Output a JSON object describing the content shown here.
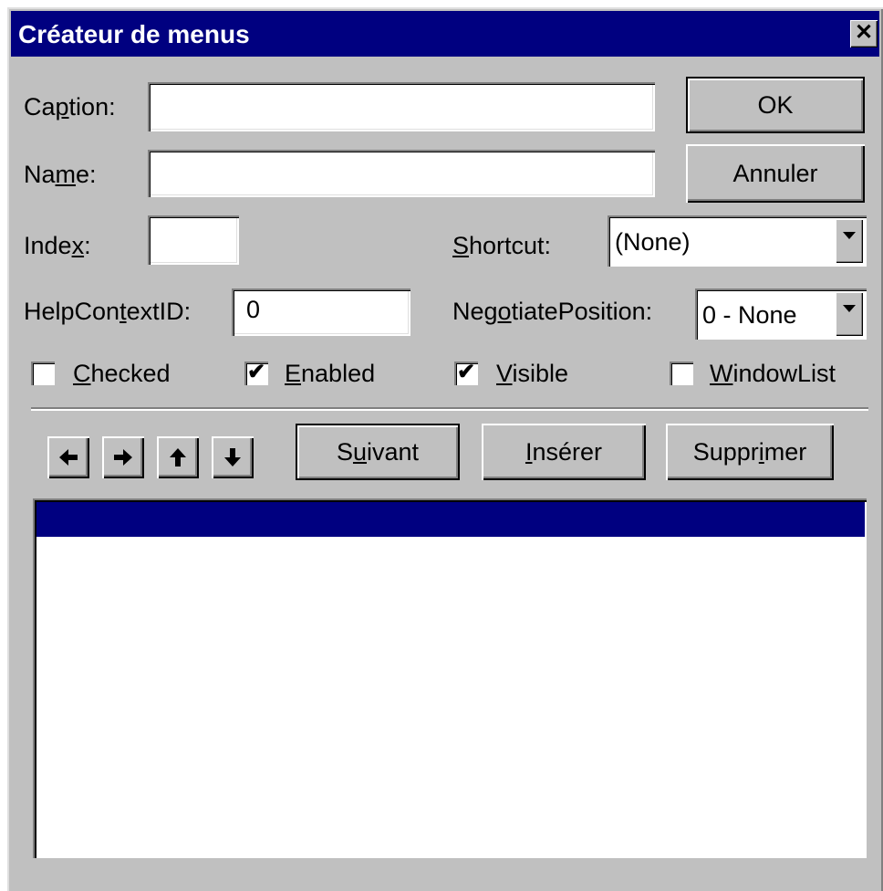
{
  "window": {
    "title": "Créateur de menus",
    "close_label": "✕"
  },
  "form": {
    "caption": {
      "label_pre": "Ca",
      "label_key": "p",
      "label_post": "tion:",
      "value": ""
    },
    "name": {
      "label_pre": "Na",
      "label_key": "m",
      "label_post": "e:",
      "value": ""
    },
    "index": {
      "label_pre": "Inde",
      "label_key": "x",
      "label_post": ":",
      "value": ""
    },
    "shortcut": {
      "label_key": "S",
      "label_post": "hortcut:",
      "value": "(None)"
    },
    "helpcontext": {
      "label_pre": "HelpCon",
      "label_key": "t",
      "label_post": "extID:",
      "value": "0"
    },
    "negotiate": {
      "label_pre": "Neg",
      "label_key": "o",
      "label_post": "tiatePosition:",
      "value": "0 - None"
    },
    "checkboxes": [
      {
        "label_key": "C",
        "label_post": "hecked",
        "checked": false
      },
      {
        "label_key": "E",
        "label_post": "nabled",
        "checked": true
      },
      {
        "label_key": "V",
        "label_post": "isible",
        "checked": true
      },
      {
        "label_key": "W",
        "label_post": "indowList",
        "checked": false
      }
    ]
  },
  "buttons": {
    "ok": "OK",
    "cancel": "Annuler",
    "next": {
      "pre": "S",
      "key": "u",
      "post": "ivant"
    },
    "insert": {
      "pre": "",
      "key": "I",
      "post": "nsérer"
    },
    "delete": {
      "pre": "Suppr",
      "key": "i",
      "post": "mer"
    }
  },
  "arrow_buttons": [
    "left-arrow-icon",
    "right-arrow-icon",
    "up-arrow-icon",
    "down-arrow-icon"
  ],
  "menu_list": {
    "items": [
      ""
    ],
    "selected_index": 0,
    "selection_color": "#000080"
  },
  "colors": {
    "title_bar": "#000080",
    "face": "#c0c0c0"
  }
}
